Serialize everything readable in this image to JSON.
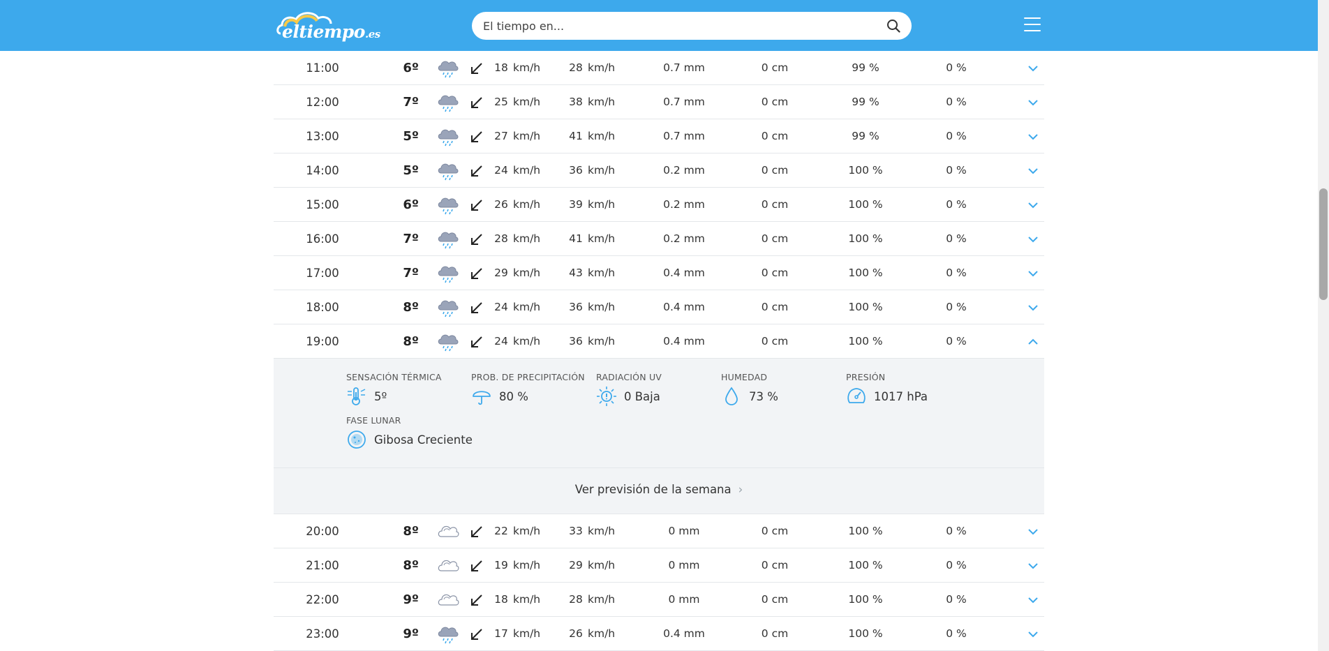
{
  "header": {
    "logo_main": "eltiempo",
    "logo_suffix": ".es",
    "search_placeholder": "El tiempo en..."
  },
  "icons": {
    "search": "search-icon",
    "menu": "hamburger-menu-icon",
    "wind": "arrow-down-left-icon",
    "collapse": "chevron-up-icon",
    "expand": "chevron-down-icon"
  },
  "colors": {
    "header": "#3da9ec",
    "accent": "#3da9ec",
    "details_bg": "#f2f4f6"
  },
  "hours_before": [
    {
      "hour": "11:00",
      "temp": "6º",
      "icon": "rain",
      "wind": "18",
      "wind_unit": "km/h",
      "gust": "28",
      "gust_unit": "km/h",
      "rain": "0.7 mm",
      "snow": "0 cm",
      "clouds": "99 %",
      "storm": "0 %"
    },
    {
      "hour": "12:00",
      "temp": "7º",
      "icon": "rain",
      "wind": "25",
      "wind_unit": "km/h",
      "gust": "38",
      "gust_unit": "km/h",
      "rain": "0.7 mm",
      "snow": "0 cm",
      "clouds": "99 %",
      "storm": "0 %"
    },
    {
      "hour": "13:00",
      "temp": "5º",
      "icon": "rain",
      "wind": "27",
      "wind_unit": "km/h",
      "gust": "41",
      "gust_unit": "km/h",
      "rain": "0.7 mm",
      "snow": "0 cm",
      "clouds": "99 %",
      "storm": "0 %"
    },
    {
      "hour": "14:00",
      "temp": "5º",
      "icon": "rain",
      "wind": "24",
      "wind_unit": "km/h",
      "gust": "36",
      "gust_unit": "km/h",
      "rain": "0.2 mm",
      "snow": "0 cm",
      "clouds": "100 %",
      "storm": "0 %"
    },
    {
      "hour": "15:00",
      "temp": "6º",
      "icon": "rain",
      "wind": "26",
      "wind_unit": "km/h",
      "gust": "39",
      "gust_unit": "km/h",
      "rain": "0.2 mm",
      "snow": "0 cm",
      "clouds": "100 %",
      "storm": "0 %"
    },
    {
      "hour": "16:00",
      "temp": "7º",
      "icon": "rain",
      "wind": "28",
      "wind_unit": "km/h",
      "gust": "41",
      "gust_unit": "km/h",
      "rain": "0.2 mm",
      "snow": "0 cm",
      "clouds": "100 %",
      "storm": "0 %"
    },
    {
      "hour": "17:00",
      "temp": "7º",
      "icon": "rain",
      "wind": "29",
      "wind_unit": "km/h",
      "gust": "43",
      "gust_unit": "km/h",
      "rain": "0.4 mm",
      "snow": "0 cm",
      "clouds": "100 %",
      "storm": "0 %"
    },
    {
      "hour": "18:00",
      "temp": "8º",
      "icon": "rain",
      "wind": "24",
      "wind_unit": "km/h",
      "gust": "36",
      "gust_unit": "km/h",
      "rain": "0.4 mm",
      "snow": "0 cm",
      "clouds": "100 %",
      "storm": "0 %"
    },
    {
      "hour": "19:00",
      "temp": "8º",
      "icon": "rain",
      "wind": "24",
      "wind_unit": "km/h",
      "gust": "36",
      "gust_unit": "km/h",
      "rain": "0.4 mm",
      "snow": "0 cm",
      "clouds": "100 %",
      "storm": "0 %",
      "expanded": true
    }
  ],
  "details": {
    "feels_like_label": "SENSACIÓN TÉRMICA",
    "feels_like_value": "5º",
    "precip_prob_label": "PROB. DE PRECIPITACIÓN",
    "precip_prob_value": "80 %",
    "uv_label": "RADIACIÓN UV",
    "uv_value": "0 Baja",
    "humidity_label": "HUMEDAD",
    "humidity_value": "73 %",
    "pressure_label": "PRESIÓN",
    "pressure_value": "1017 hPa",
    "moon_label": "FASE LUNAR",
    "moon_value": "Gibosa Creciente"
  },
  "week_link": "Ver previsión de la semana",
  "hours_after": [
    {
      "hour": "20:00",
      "temp": "8º",
      "icon": "cloud",
      "wind": "22",
      "wind_unit": "km/h",
      "gust": "33",
      "gust_unit": "km/h",
      "rain": "0 mm",
      "snow": "0 cm",
      "clouds": "100 %",
      "storm": "0 %"
    },
    {
      "hour": "21:00",
      "temp": "8º",
      "icon": "cloud",
      "wind": "19",
      "wind_unit": "km/h",
      "gust": "29",
      "gust_unit": "km/h",
      "rain": "0 mm",
      "snow": "0 cm",
      "clouds": "100 %",
      "storm": "0 %"
    },
    {
      "hour": "22:00",
      "temp": "9º",
      "icon": "cloud",
      "wind": "18",
      "wind_unit": "km/h",
      "gust": "28",
      "gust_unit": "km/h",
      "rain": "0 mm",
      "snow": "0 cm",
      "clouds": "100 %",
      "storm": "0 %"
    },
    {
      "hour": "23:00",
      "temp": "9º",
      "icon": "rain",
      "wind": "17",
      "wind_unit": "km/h",
      "gust": "26",
      "gust_unit": "km/h",
      "rain": "0.4 mm",
      "snow": "0 cm",
      "clouds": "100 %",
      "storm": "0 %"
    }
  ]
}
